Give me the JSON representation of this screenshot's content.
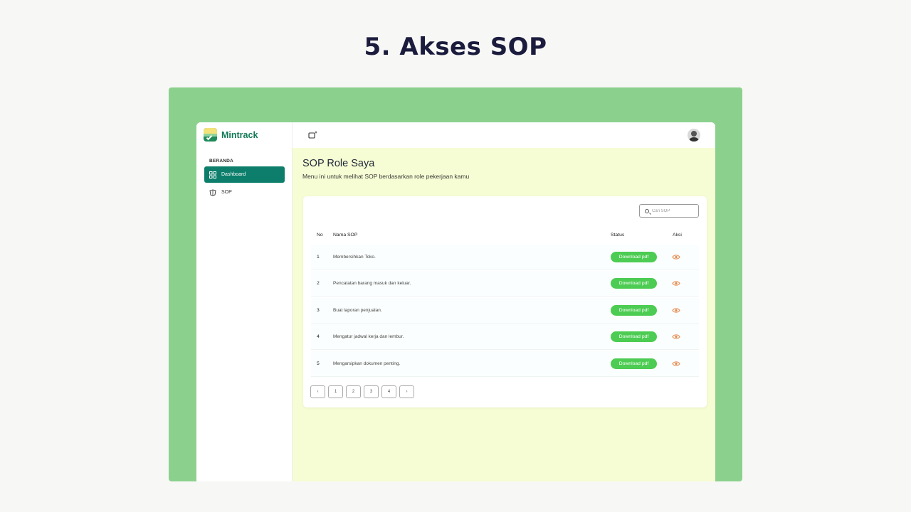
{
  "slide_title": "5. Akses SOP",
  "brand": {
    "name": "Mintrack"
  },
  "sidebar": {
    "section_label": "BERANDA",
    "items": [
      {
        "label": "Dashboard",
        "icon": "grid-icon",
        "active": true
      },
      {
        "label": "SOP",
        "icon": "sop-icon",
        "active": false
      }
    ]
  },
  "topbar": {
    "icon": "window-sparkle-icon",
    "avatar": "user-avatar"
  },
  "page": {
    "title": "SOP Role Saya",
    "subtitle": "Menu ini untuk melihat SOP berdasarkan role pekerjaan kamu"
  },
  "search": {
    "placeholder": "Cari SOP",
    "value": ""
  },
  "table": {
    "headers": {
      "no": "No",
      "nama": "Nama SOP",
      "status": "Status",
      "aksi": "Aksi"
    },
    "rows": [
      {
        "no": "1",
        "nama": "Membersihkan Toko.",
        "status": "Download pdf"
      },
      {
        "no": "2",
        "nama": "Pencatatan barang masuk dan keluar.",
        "status": "Download pdf"
      },
      {
        "no": "3",
        "nama": "Buat laporan penjualan.",
        "status": "Download pdf"
      },
      {
        "no": "4",
        "nama": "Mengatur jadwal kerja dan lembur.",
        "status": "Download pdf"
      },
      {
        "no": "5",
        "nama": "Mengarsipkan dokumen penting.",
        "status": "Download pdf"
      }
    ]
  },
  "pagination": {
    "prev": "‹",
    "pages": [
      "1",
      "2",
      "3",
      "4"
    ],
    "next": "›"
  },
  "colors": {
    "accent": "#0c7e6b",
    "download": "#4ccc52",
    "eye": "#e8894e",
    "panel": "#8bd18d",
    "content_bg": "#f6fcd3"
  }
}
